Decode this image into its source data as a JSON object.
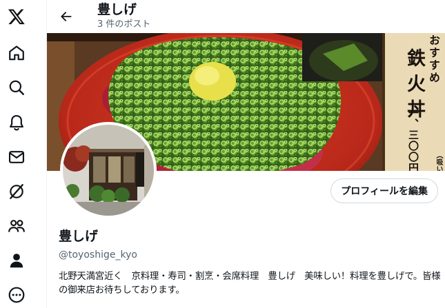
{
  "nav": {
    "items": [
      {
        "name": "x-logo-icon"
      },
      {
        "name": "home-icon"
      },
      {
        "name": "explore-icon"
      },
      {
        "name": "notifications-icon"
      },
      {
        "name": "messages-icon"
      },
      {
        "name": "grok-icon"
      },
      {
        "name": "communities-icon"
      },
      {
        "name": "profile-icon"
      },
      {
        "name": "more-icon"
      }
    ]
  },
  "header": {
    "title": "豊しげ",
    "post_count": "3 件のポスト"
  },
  "banner": {
    "sign_small": "おすすめ",
    "sign_large": "鉄火丼",
    "sign_price": "一、三〇〇円",
    "sign_note": "（吸い"
  },
  "profile": {
    "edit_button": "プロフィールを編集",
    "display_name": "豊しげ",
    "handle": "@toyoshige_kyo",
    "bio": "北野天満宮近く　京料理・寿司・割烹・会席料理　豊しげ　美味しい！料理を豊しげで。皆様の御来店お待ちしております。"
  },
  "colors": {
    "text_primary": "#0f1419",
    "text_secondary": "#536471",
    "border": "#cfd9de",
    "bowl_red": "#c4301e",
    "scallion_green": "#4f8a1e"
  }
}
